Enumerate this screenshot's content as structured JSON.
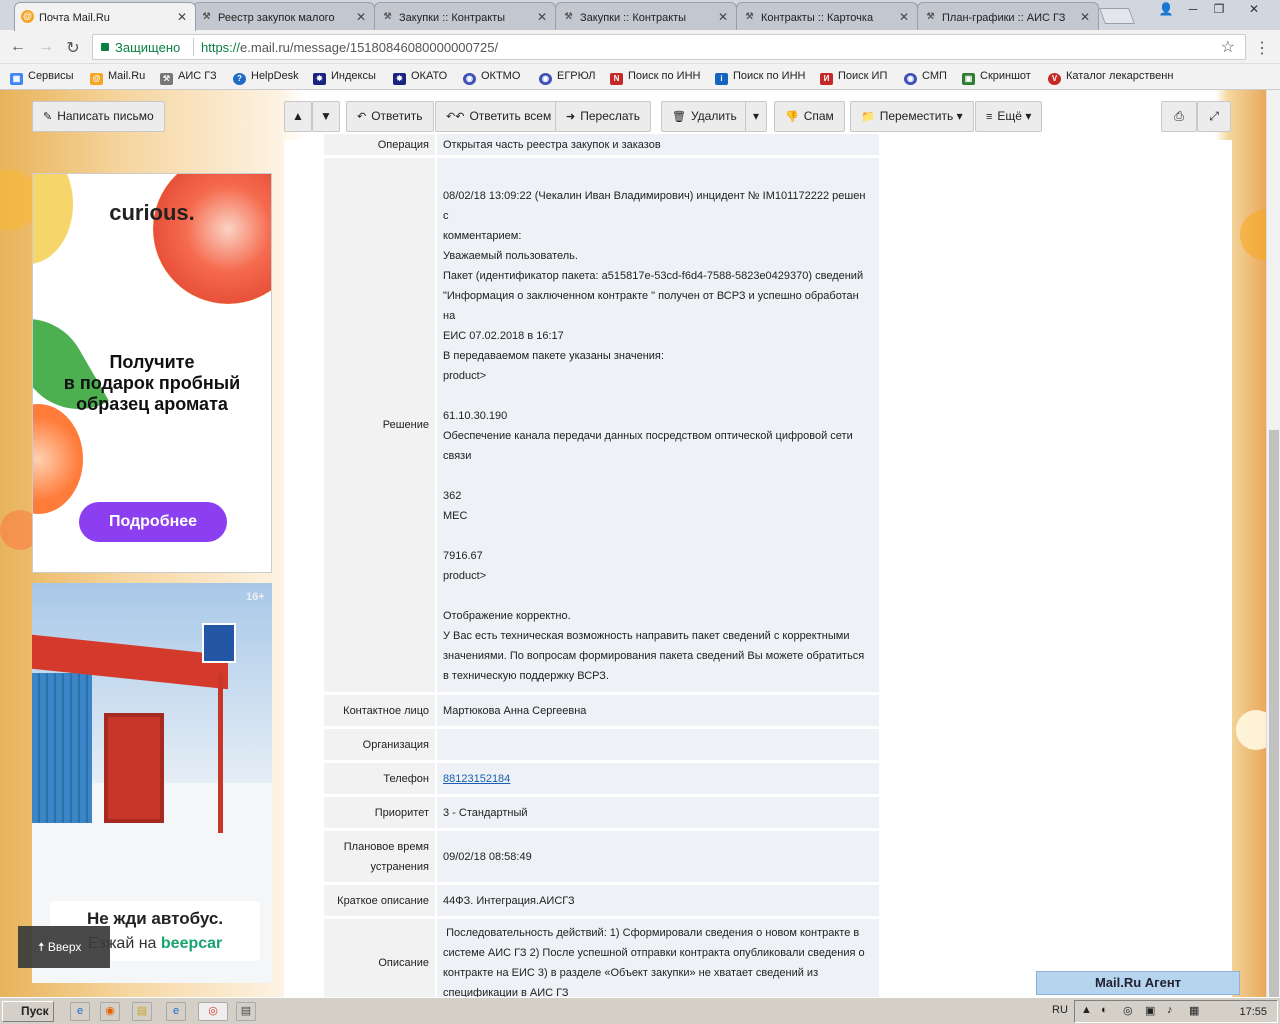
{
  "browser": {
    "tabs": [
      {
        "label": "Почта Mail.Ru",
        "icon": "mailru-icon",
        "active": true
      },
      {
        "label": "Реестр закупок малого",
        "icon": "tool-icon"
      },
      {
        "label": "Закупки :: Контракты",
        "icon": "tool-icon"
      },
      {
        "label": "Закупки :: Контракты",
        "icon": "tool-icon"
      },
      {
        "label": "Контракты :: Карточка",
        "icon": "tool-icon"
      },
      {
        "label": "План-графики :: АИС ГЗ",
        "icon": "tool-icon"
      }
    ],
    "secure_label": "Защищено",
    "url_proto": "https://",
    "url_rest": "e.mail.ru/message/15180846080000000725/",
    "bookmarks": [
      {
        "label": "Сервисы",
        "color": "#4285f4"
      },
      {
        "label": "Mail.Ru",
        "color": "#f5a623"
      },
      {
        "label": "АИС ГЗ",
        "color": "#555555"
      },
      {
        "label": "HelpDesk",
        "color": "#1e6bc4"
      },
      {
        "label": "Индексы",
        "color": "#1a237e"
      },
      {
        "label": "ОКАТО",
        "color": "#1a237e"
      },
      {
        "label": "ОКТМО",
        "color": "#3f51b5"
      },
      {
        "label": "ЕГРЮЛ",
        "color": "#3f51b5"
      },
      {
        "label": "Поиск по ИНН",
        "color": "#c62828"
      },
      {
        "label": "Поиск по ИНН",
        "color": "#1565c0"
      },
      {
        "label": "Поиск ИП",
        "color": "#c62828"
      },
      {
        "label": "СМП",
        "color": "#3f51b5"
      },
      {
        "label": "Скриншот",
        "color": "#2e7d32"
      },
      {
        "label": "Каталог лекарственн",
        "color": "#c62828"
      }
    ]
  },
  "toolbar": {
    "compose": "Написать письмо",
    "reply": "Ответить",
    "reply_all": "Ответить всем",
    "forward": "Переслать",
    "delete": "Удалить",
    "spam": "Спам",
    "move": "Переместить",
    "more": "Ещё"
  },
  "message": {
    "operation": {
      "label": "Операция",
      "value": "Открытая часть реестра закупок и заказов"
    },
    "solution": {
      "label": "Решение",
      "lines": [
        "",
        "08/02/18 13:09:22 (Чекалин Иван Владимирович) инцидент № IM101172222 решен с",
        "комментарием:",
        "Уважаемый пользователь.",
        "Пакет (идентификатор пакета: a515817e-53cd-f6d4-7588-5823e0429370) сведений",
        "\"Информация о заключенном контракте \" получен от ВСРЗ и успешно обработан на",
        "ЕИС 07.02.2018 в 16:17",
        "В передаваемом пакете указаны значения:",
        "product>",
        "",
        "61.10.30.190",
        "Обеспечение канала передачи данных посредством оптической цифровой сети",
        "связи",
        "",
        "362",
        "МЕС",
        "",
        "7916.67",
        "product>",
        "",
        "Отображение корректно.",
        "У Вас есть техническая возможность направить пакет сведений с корректными",
        "значениями. По вопросам формирования пакета сведений Вы можете обратиться",
        "в техническую поддержку ВСРЗ."
      ]
    },
    "contact": {
      "label": "Контактное лицо",
      "value": "Мартюкова Анна Сергеевна"
    },
    "organization": {
      "label": "Организация",
      "value": ""
    },
    "phone": {
      "label": "Телефон",
      "value": "88123152184"
    },
    "priority": {
      "label": "Приоритет",
      "value": "3 - Стандартный"
    },
    "planned_time": {
      "label_1": "Плановое время",
      "label_2": "устранения",
      "value": "09/02/18 08:58:49"
    },
    "short_desc": {
      "label": "Краткое описание",
      "value": "44ФЗ. Интеграция.АИСГЗ"
    },
    "description": {
      "label": "Описание",
      "lines": [
        " Последовательность действий: 1) Сформировали сведения о новом контракте в",
        "системе АИС ГЗ 2) После успешной отправки контракта опубликовали сведения о",
        "контракте на ЕИС 3) в разделе «Объект закупки» не хватает сведений из",
        "спецификации в АИС ГЗ"
      ]
    }
  },
  "ads": {
    "ad1_brand": "curious.",
    "ad1_line1": "Получите",
    "ad1_line2": "в подарок пробный",
    "ad1_line3": "образец аромата",
    "ad1_button": "Подробнее",
    "ad2_age": "16+",
    "ad2_line1": "Не жди автобус.",
    "ad2_line2_prefix": "Езжай на",
    "ad2_brand": "beepcar"
  },
  "up_button": "Вверх",
  "agent_bar": "Mail.Ru Агент",
  "taskbar": {
    "start": "Пуск",
    "lang": "RU",
    "clock": "17:55"
  }
}
